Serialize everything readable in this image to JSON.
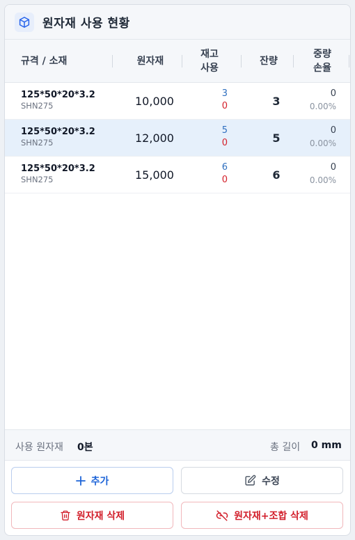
{
  "header": {
    "title": "원자재 사용 현황",
    "icon": "cube-icon",
    "accent": "#2563eb"
  },
  "table": {
    "columns": {
      "spec": "규격 / 소재",
      "raw": "원자재",
      "stock_line1": "재고",
      "stock_line2": "사용",
      "remain": "잔량",
      "loss_line1": "중량",
      "loss_line2": "손율"
    },
    "rows": [
      {
        "spec": "125*50*20*3.2",
        "material": "SHN275",
        "raw": "10,000",
        "stock": "3",
        "used": "0",
        "remain": "3",
        "loss": "0",
        "loss_pct": "0.00%",
        "selected": false
      },
      {
        "spec": "125*50*20*3.2",
        "material": "SHN275",
        "raw": "12,000",
        "stock": "5",
        "used": "0",
        "remain": "5",
        "loss": "0",
        "loss_pct": "0.00%",
        "selected": true
      },
      {
        "spec": "125*50*20*3.2",
        "material": "SHN275",
        "raw": "15,000",
        "stock": "6",
        "used": "0",
        "remain": "6",
        "loss": "0",
        "loss_pct": "0.00%",
        "selected": false
      }
    ]
  },
  "summary": {
    "used_label": "사용 원자재",
    "used_value": "0본",
    "total_label": "총 길이",
    "total_value": "0 mm"
  },
  "buttons": {
    "add": "추가",
    "edit": "수정",
    "delete_raw": "원자재 삭제",
    "delete_raw_combo": "원자재+조합 삭제"
  },
  "colors": {
    "stock_blue": "#2f6fbf",
    "used_red": "#d4202a",
    "selected_row": "#e6f0fb",
    "danger": "#d21f2b"
  }
}
